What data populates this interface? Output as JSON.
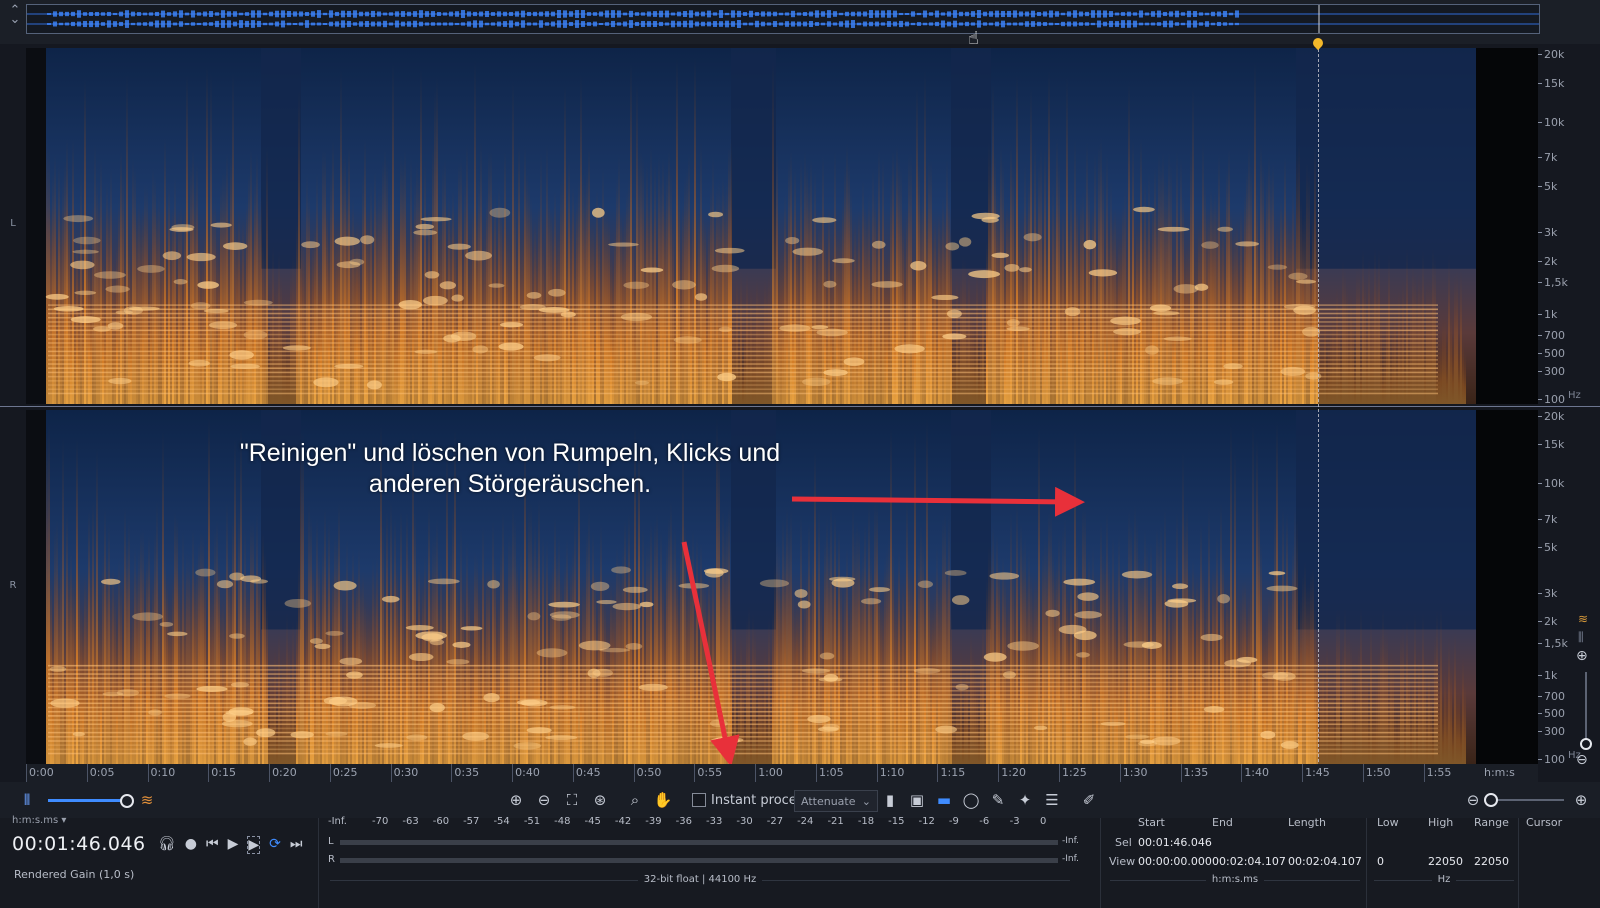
{
  "overview": {
    "collapse_icon": "collapse-chevrons-icon"
  },
  "channels": {
    "left_label": "L",
    "right_label": "R"
  },
  "freq_axis": {
    "labels": [
      "20k",
      "15k",
      "10k",
      "7k",
      "5k",
      "3k",
      "2k",
      "1,5k",
      "1k",
      "700",
      "500",
      "300",
      "100"
    ],
    "unit": "Hz"
  },
  "time_ruler": {
    "labels": [
      "0:00",
      "0:05",
      "0:10",
      "0:15",
      "0:20",
      "0:25",
      "0:30",
      "0:35",
      "0:40",
      "0:45",
      "0:50",
      "0:55",
      "1:00",
      "1:05",
      "1:10",
      "1:15",
      "1:20",
      "1:25",
      "1:30",
      "1:35",
      "1:40",
      "1:45",
      "1:50",
      "1:55"
    ],
    "unit": "h:m:s"
  },
  "annotation": {
    "line1": "\"Reinigen\" und löschen von Rumpeln, Klicks und",
    "line2": "anderen Störgeräuschen."
  },
  "toolbar": {
    "instant_process_label": "Instant process",
    "instant_process_checked": false,
    "mode_value": "Attenuate",
    "waveform_spectrogram_ratio": 0.98,
    "icons": [
      "waveform-view-icon",
      "spectrogram-view-icon",
      "zoom-in-icon",
      "zoom-out-icon",
      "zoom-selection-icon",
      "zoom-fit-icon",
      "magnify-icon",
      "hand-tool-icon",
      "time-select-icon",
      "time-frequency-select-icon",
      "frequency-select-icon",
      "lasso-icon",
      "brush-select-icon",
      "magic-wand-icon",
      "harmonic-select-icon",
      "pencil-icon"
    ]
  },
  "transport": {
    "time_format": "h:m:s.ms",
    "timecode": "00:01:46.046",
    "rendered_gain": "Rendered Gain (1,0 s)"
  },
  "meter": {
    "scale": [
      "-Inf.",
      "-70",
      "-63",
      "-60",
      "-57",
      "-54",
      "-51",
      "-48",
      "-45",
      "-42",
      "-39",
      "-36",
      "-33",
      "-30",
      "-27",
      "-24",
      "-21",
      "-18",
      "-15",
      "-12",
      "-9",
      "-6",
      "-3",
      "0"
    ],
    "left_label": "L",
    "right_label": "R",
    "left_peak": "-Inf.",
    "right_peak": "-Inf.",
    "format_info": "32-bit float | 44100 Hz"
  },
  "selection": {
    "headers": {
      "start": "Start",
      "end": "End",
      "length": "Length",
      "low": "Low",
      "high": "High",
      "range": "Range",
      "cursor": "Cursor"
    },
    "sel_label": "Sel",
    "sel_start": "00:01:46.046",
    "view_label": "View",
    "view_start": "00:00:00.000",
    "view_end": "00:02:04.107",
    "view_length": "00:02:04.107",
    "low": "0",
    "high": "22050",
    "range": "22050",
    "time_unit": "h:m:s.ms",
    "freq_unit": "Hz"
  },
  "colors": {
    "accent": "#3f8cff",
    "playhead": "#f3b82a",
    "arrow": "#e8303a",
    "spectrum_hot": "#ff9a2a",
    "spectrum_bg": "#1c3466"
  }
}
